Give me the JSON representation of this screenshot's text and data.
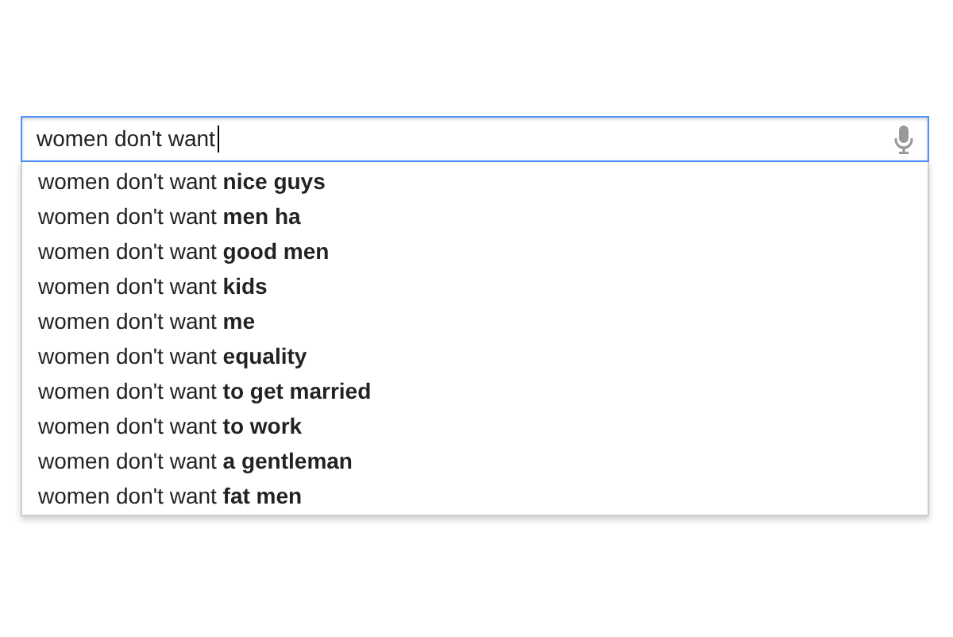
{
  "search": {
    "value": "women don't want"
  },
  "suggestions": [
    {
      "text": "women don't want **nice guys**"
    },
    {
      "text": "women don't want **men ha**"
    },
    {
      "text": "women don't want **good men**"
    },
    {
      "text": "women don't want **kids**"
    },
    {
      "text": "women don't want **me**"
    },
    {
      "text": "women don't want **equality**"
    },
    {
      "text": "women don't want **to get married**"
    },
    {
      "text": "women don't want **to work**"
    },
    {
      "text": "women don't want **a gentleman**"
    },
    {
      "text": "women don't want **fat men**"
    }
  ]
}
